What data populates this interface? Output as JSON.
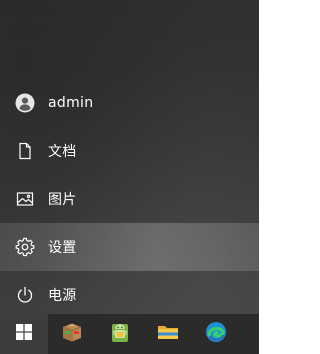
{
  "start_menu": {
    "items": [
      {
        "label": "admin",
        "icon": "user-avatar-icon"
      },
      {
        "label": "文档",
        "icon": "document-icon"
      },
      {
        "label": "图片",
        "icon": "picture-icon"
      },
      {
        "label": "设置",
        "icon": "gear-icon",
        "state": "hover"
      },
      {
        "label": "电源",
        "icon": "power-icon"
      }
    ]
  },
  "taskbar": {
    "items": [
      {
        "name": "start",
        "icon": "windows-logo-icon",
        "state": "active"
      },
      {
        "name": "store-app",
        "icon": "package-box-icon"
      },
      {
        "name": "android-app",
        "icon": "android-icon"
      },
      {
        "name": "file-explorer",
        "icon": "folder-icon"
      },
      {
        "name": "edge-browser",
        "icon": "edge-icon"
      }
    ]
  },
  "colors": {
    "menu_text": "#ffffff",
    "taskbar_bg": "#2b2b2b",
    "hover_bg": "#5a5b5a"
  }
}
